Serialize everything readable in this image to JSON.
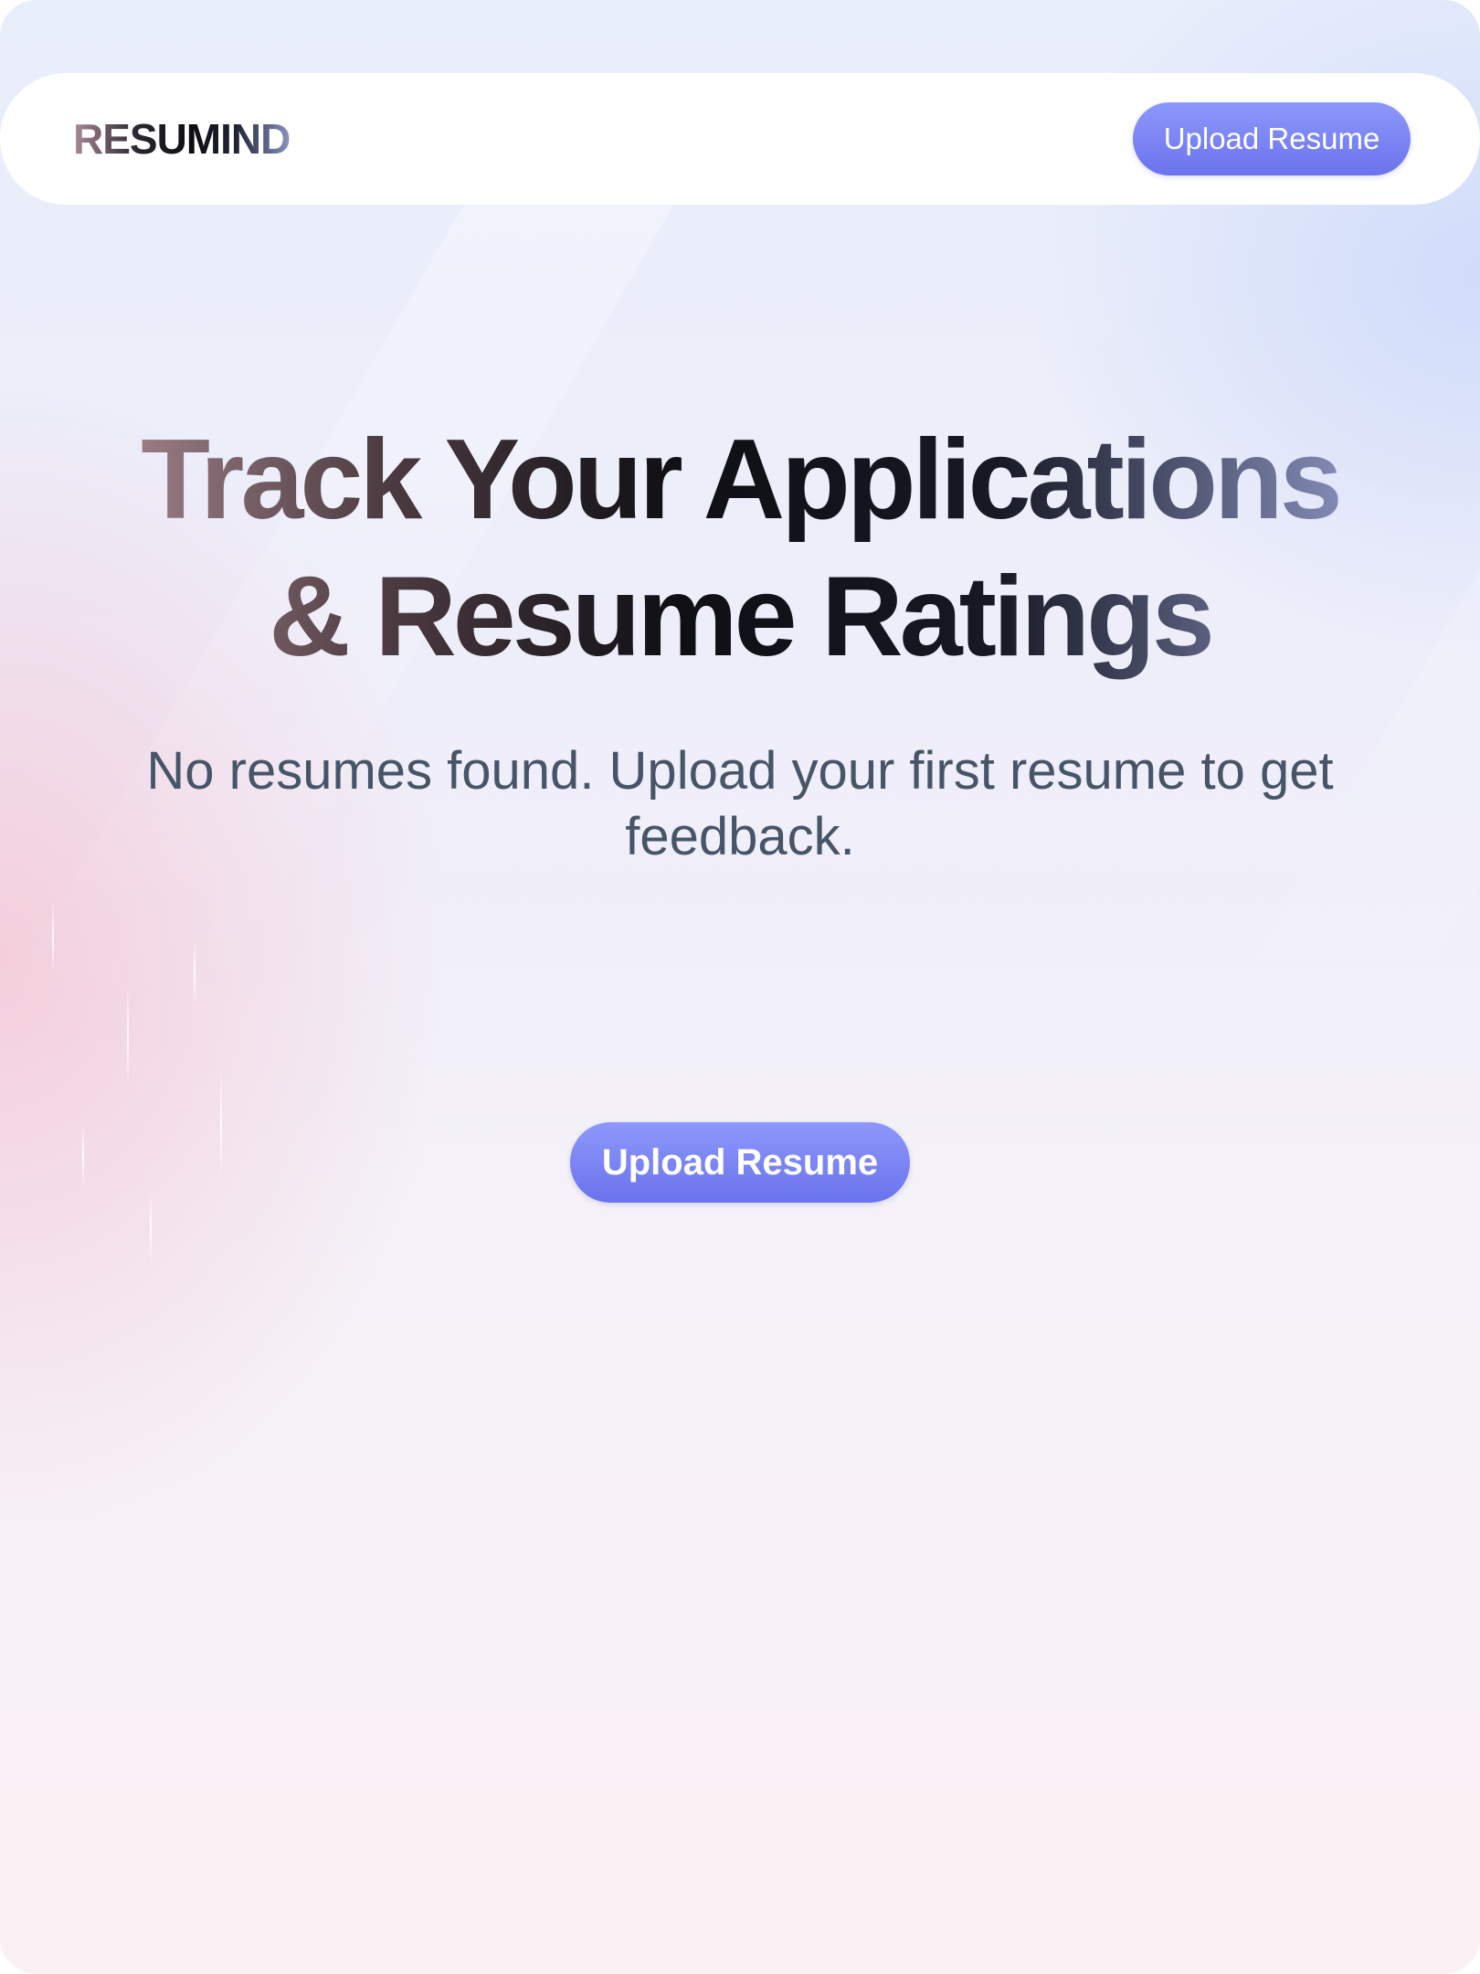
{
  "app": {
    "brand": "RESUMIND"
  },
  "navbar": {
    "upload_label": "Upload Resume"
  },
  "hero": {
    "title": "Track Your Applications & Resume Ratings",
    "subtitle": "No resumes found. Upload your first resume to get feedback."
  },
  "empty_state": {
    "cta_label": "Upload Resume"
  },
  "colors": {
    "accent": "#7c84f5",
    "subtitle_text": "#475569"
  }
}
